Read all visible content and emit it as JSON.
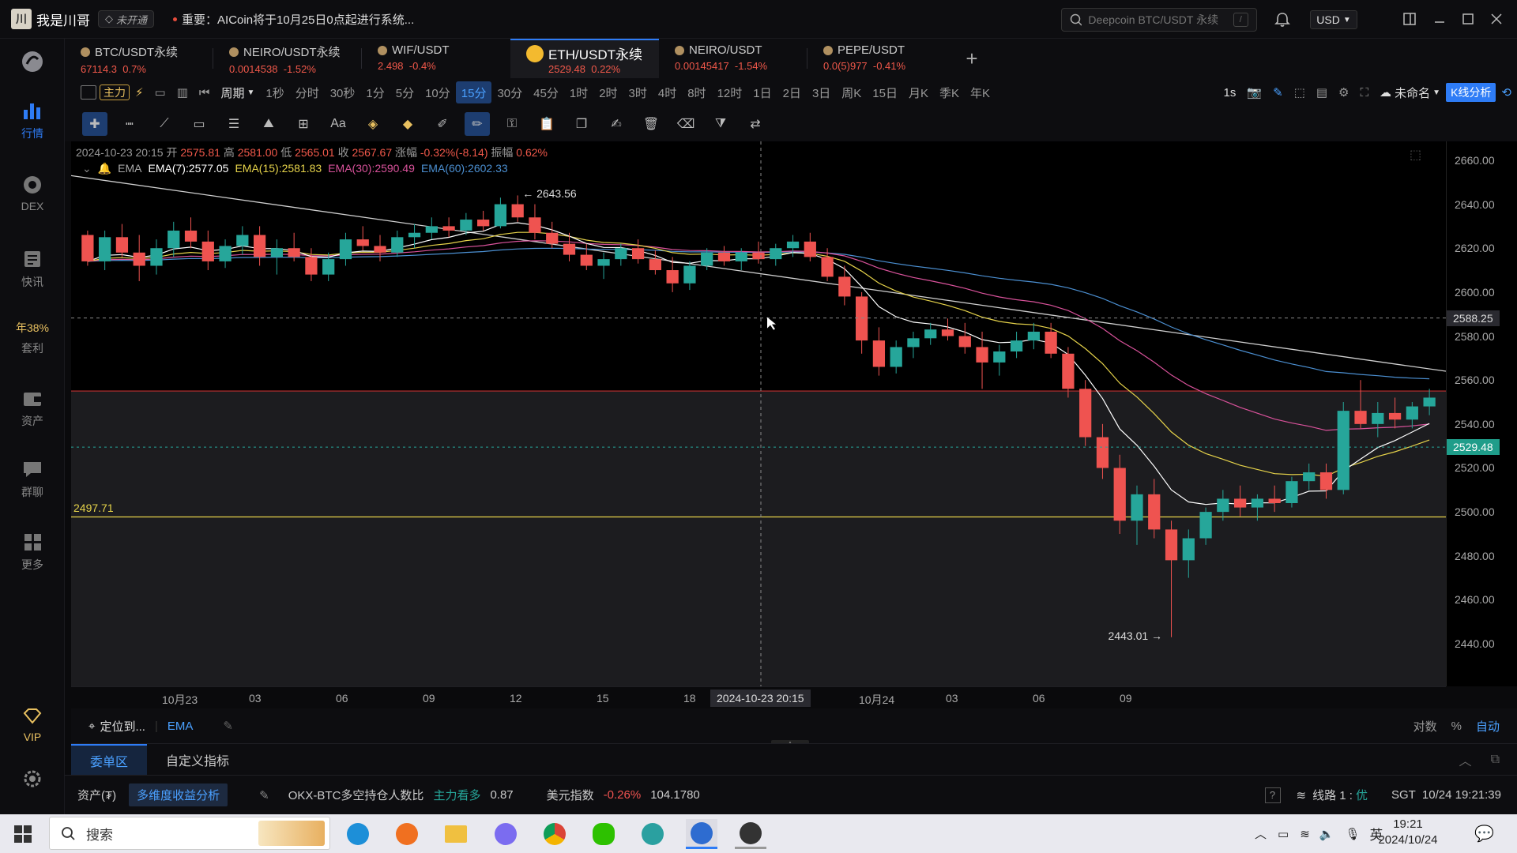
{
  "titlebar": {
    "username": "我是川哥",
    "vip_badge": "未开通",
    "notice": "重要：AICoin将于10月25日0点起进行系统...",
    "search_placeholder": "Deepcoin BTC/USDT 永续",
    "search_key": "/",
    "currency": "USD"
  },
  "sidebar": {
    "items": [
      {
        "label": ""
      },
      {
        "label": "行情"
      },
      {
        "label": "DEX"
      },
      {
        "label": "快讯"
      },
      {
        "label": "年38%"
      },
      {
        "label": "套利"
      },
      {
        "label": "资产"
      },
      {
        "label": "群聊"
      },
      {
        "label": "更多"
      },
      {
        "label": "VIP"
      }
    ]
  },
  "tabs": [
    {
      "name": "BTC/USDT永续",
      "price": "67114.3",
      "change": "0.7%"
    },
    {
      "name": "NEIRO/USDT永续",
      "price": "0.0014538",
      "change": "-1.52%"
    },
    {
      "name": "WIF/USDT",
      "price": "2.498",
      "change": "-0.4%"
    },
    {
      "name": "ETH/USDT永续",
      "price": "2529.48",
      "change": "0.22%"
    },
    {
      "name": "NEIRO/USDT",
      "price": "0.00145417",
      "change": "-1.54%"
    },
    {
      "name": "PEPE/USDT",
      "price": "0.0(5)977",
      "change": "-0.41%"
    }
  ],
  "toolbar": {
    "main_label": "主力",
    "period_label": "周期",
    "periods": [
      "1秒",
      "分时",
      "30秒",
      "1分",
      "5分",
      "10分",
      "15分",
      "30分",
      "45分",
      "1时",
      "2时",
      "3时",
      "4时",
      "8时",
      "12时",
      "1日",
      "2日",
      "3日",
      "周K",
      "15日",
      "月K",
      "季K",
      "年K"
    ],
    "active_period": "15分",
    "interval_label": "1s",
    "layout_name": "未命名",
    "kline_button": "K线分析"
  },
  "chart": {
    "info": {
      "datetime": "2024-10-23 20:15",
      "open_label": "开",
      "open": "2575.81",
      "high_label": "高",
      "high": "2581.00",
      "low_label": "低",
      "low": "2565.01",
      "close_label": "收",
      "close": "2567.67",
      "amp_label": "涨幅",
      "amp": "-0.32%(-8.14)",
      "range_label": "振幅",
      "range": "0.62%"
    },
    "ema": {
      "label": "EMA",
      "ema7": "EMA(7):2577.05",
      "ema15": "EMA(15):2581.83",
      "ema30": "EMA(30):2590.49",
      "ema60": "EMA(60):2602.33"
    },
    "high_annot": "2643.56",
    "low_annot": "2443.01",
    "hline_label": "2497.71",
    "crosshair_price": "2588.25",
    "last_price": "2529.48",
    "crosshair_time": "2024-10-23 20:15",
    "colors": {
      "up": "#26a69a",
      "down": "#ef5350",
      "ema7": "#ffffff",
      "ema15": "#e6d34a",
      "ema30": "#d9529b",
      "ema60": "#4b8fd1"
    }
  },
  "chart_data": {
    "type": "candlestick",
    "ylim": [
      2435,
      2665
    ],
    "yticks": [
      "2660.00",
      "2640.00",
      "2620.00",
      "2600.00",
      "2580.00",
      "2560.00",
      "2540.00",
      "2520.00",
      "2500.00",
      "2480.00",
      "2460.00",
      "2440.00"
    ],
    "xticks": [
      "10月23",
      "03",
      "06",
      "09",
      "12",
      "15",
      "18",
      "10月24",
      "03",
      "06",
      "09"
    ],
    "candles": [
      [
        2626,
        2628,
        2612,
        2614
      ],
      [
        2614,
        2628,
        2610,
        2625
      ],
      [
        2625,
        2631,
        2616,
        2618
      ],
      [
        2618,
        2626,
        2605,
        2612
      ],
      [
        2612,
        2624,
        2608,
        2620
      ],
      [
        2620,
        2632,
        2616,
        2628
      ],
      [
        2628,
        2634,
        2620,
        2623
      ],
      [
        2623,
        2628,
        2610,
        2614
      ],
      [
        2614,
        2624,
        2611,
        2621
      ],
      [
        2621,
        2630,
        2617,
        2626
      ],
      [
        2626,
        2630,
        2612,
        2616
      ],
      [
        2616,
        2624,
        2608,
        2620
      ],
      [
        2620,
        2627,
        2614,
        2616
      ],
      [
        2616,
        2620,
        2605,
        2608
      ],
      [
        2608,
        2618,
        2605,
        2615
      ],
      [
        2615,
        2627,
        2612,
        2624
      ],
      [
        2624,
        2630,
        2619,
        2621
      ],
      [
        2621,
        2626,
        2614,
        2618
      ],
      [
        2618,
        2628,
        2616,
        2625
      ],
      [
        2625,
        2631,
        2620,
        2627
      ],
      [
        2627,
        2634,
        2624,
        2630
      ],
      [
        2630,
        2634,
        2625,
        2628
      ],
      [
        2628,
        2636,
        2626,
        2633
      ],
      [
        2633,
        2637,
        2628,
        2630
      ],
      [
        2630,
        2643,
        2629,
        2640
      ],
      [
        2640,
        2644,
        2632,
        2634
      ],
      [
        2634,
        2640,
        2624,
        2627
      ],
      [
        2627,
        2632,
        2620,
        2622
      ],
      [
        2622,
        2627,
        2614,
        2617
      ],
      [
        2617,
        2622,
        2610,
        2612
      ],
      [
        2612,
        2618,
        2606,
        2615
      ],
      [
        2615,
        2622,
        2612,
        2620
      ],
      [
        2620,
        2624,
        2613,
        2615
      ],
      [
        2615,
        2619,
        2608,
        2610
      ],
      [
        2610,
        2616,
        2600,
        2604
      ],
      [
        2604,
        2614,
        2601,
        2612
      ],
      [
        2612,
        2620,
        2610,
        2618
      ],
      [
        2618,
        2621,
        2612,
        2614
      ],
      [
        2614,
        2620,
        2610,
        2618
      ],
      [
        2618,
        2623,
        2613,
        2615
      ],
      [
        2615,
        2622,
        2612,
        2620
      ],
      [
        2620,
        2626,
        2616,
        2623
      ],
      [
        2623,
        2627,
        2614,
        2616
      ],
      [
        2616,
        2620,
        2605,
        2607
      ],
      [
        2607,
        2612,
        2594,
        2598
      ],
      [
        2598,
        2600,
        2572,
        2578
      ],
      [
        2578,
        2584,
        2562,
        2566
      ],
      [
        2566,
        2578,
        2563,
        2575
      ],
      [
        2575,
        2582,
        2570,
        2579
      ],
      [
        2579,
        2586,
        2576,
        2583
      ],
      [
        2583,
        2588,
        2578,
        2580
      ],
      [
        2580,
        2586,
        2572,
        2575
      ],
      [
        2575,
        2582,
        2556,
        2568
      ],
      [
        2568,
        2576,
        2562,
        2573
      ],
      [
        2573,
        2582,
        2570,
        2578
      ],
      [
        2578,
        2586,
        2574,
        2582
      ],
      [
        2582,
        2586,
        2570,
        2572
      ],
      [
        2572,
        2575,
        2552,
        2556
      ],
      [
        2556,
        2560,
        2530,
        2534
      ],
      [
        2534,
        2540,
        2515,
        2520
      ],
      [
        2520,
        2526,
        2490,
        2496
      ],
      [
        2496,
        2512,
        2485,
        2508
      ],
      [
        2508,
        2515,
        2488,
        2492
      ],
      [
        2492,
        2496,
        2443,
        2478
      ],
      [
        2478,
        2492,
        2470,
        2488
      ],
      [
        2488,
        2502,
        2485,
        2500
      ],
      [
        2500,
        2510,
        2496,
        2506
      ],
      [
        2506,
        2512,
        2498,
        2502
      ],
      [
        2502,
        2508,
        2496,
        2506
      ],
      [
        2506,
        2512,
        2500,
        2504
      ],
      [
        2504,
        2516,
        2502,
        2514
      ],
      [
        2514,
        2522,
        2510,
        2518
      ],
      [
        2518,
        2522,
        2506,
        2510
      ],
      [
        2510,
        2550,
        2508,
        2546
      ],
      [
        2546,
        2560,
        2538,
        2540
      ],
      [
        2540,
        2550,
        2534,
        2545
      ],
      [
        2545,
        2552,
        2538,
        2542
      ],
      [
        2542,
        2550,
        2538,
        2548
      ],
      [
        2548,
        2556,
        2544,
        2552
      ]
    ]
  },
  "locbar": {
    "locate": "定位到...",
    "indicator": "EMA",
    "log_label": "对数",
    "pct_label": "%",
    "auto_label": "自动"
  },
  "panel": {
    "tab1": "委单区",
    "tab2": "自定义指标"
  },
  "statusbar": {
    "assets": "资产(₮)",
    "analysis": "多维度收益分析",
    "okx_label": "OKX-BTC多空持仓人数比",
    "okx_tag": "主力看多",
    "okx_value": "0.87",
    "usd_label": "美元指数",
    "usd_change": "-0.26%",
    "usd_value": "104.1780",
    "line_label": "线路 1 :",
    "line_quality": "优",
    "time": "SGT  10/24 19:21:39"
  },
  "taskbar": {
    "search_label": "搜索",
    "ime": "英",
    "time": "19:21",
    "date": "2024/10/24"
  }
}
